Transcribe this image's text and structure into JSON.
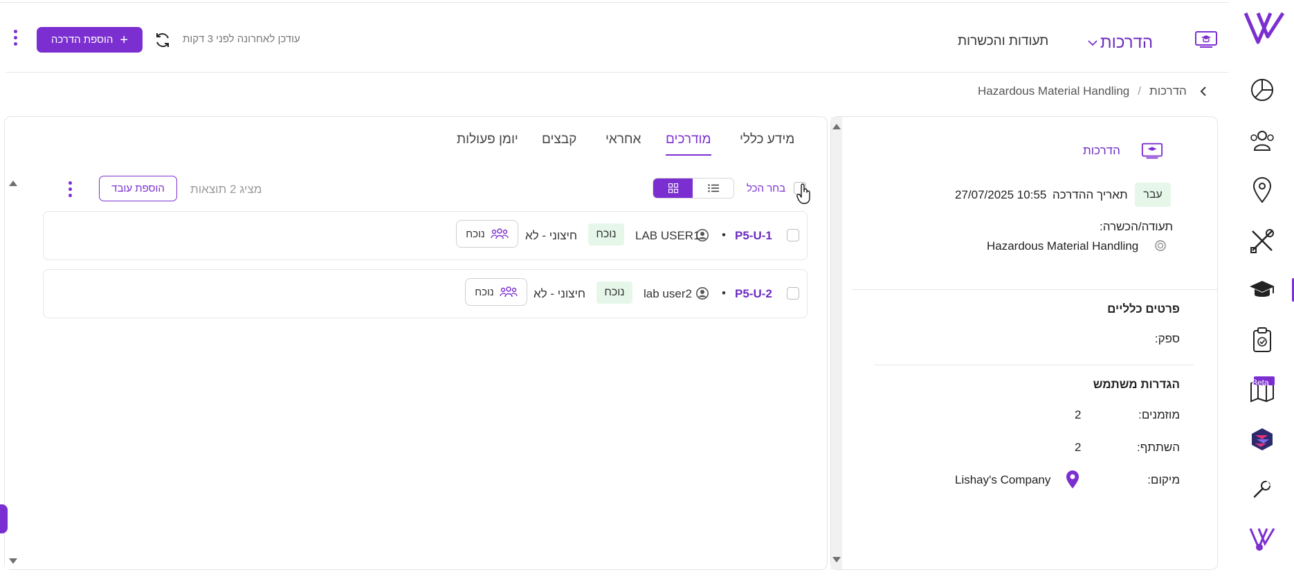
{
  "colors": {
    "accent": "#7b2fd0",
    "success_bg": "#e6f7ea"
  },
  "header": {
    "nav_trainings": "הדרכות",
    "nav_certs": "תעודות והכשרות",
    "updated_text": "עודכן לאחרונה לפני 3 דקות",
    "add_training": "הוספת הדרכה",
    "add_icon": "+"
  },
  "breadcrumb": {
    "root": "הדרכות",
    "separator": "/",
    "current": "Hazardous Material Handling"
  },
  "details": {
    "section_title": "הדרכות",
    "status": "עבר",
    "date_label": "תאריך ההדרכה",
    "date_value": "27/07/2025 10:55",
    "cert_label": "תעודה/הכשרה:",
    "cert_value": "Hazardous Material Handling",
    "general_title": "פרטים כלליים",
    "supplier_label": "ספק:",
    "user_settings_title": "הגדרות משתמש",
    "invited_label": "מוזמנים:",
    "invited_value": "2",
    "participated_label": "השתתף:",
    "participated_value": "2",
    "location_label": "מיקום:",
    "location_value": "Lishay's Company"
  },
  "tabs": [
    "מידע כללי",
    "מודרכים",
    "אחראי",
    "קבצים",
    "יומן פעולות"
  ],
  "toolbar": {
    "select_all": "בחר הכל",
    "showing": "מציג 2 תוצאות",
    "add_worker": "הוספת עובד"
  },
  "rows": [
    {
      "code": "P5-U-1",
      "bullet": "•",
      "user": "LAB USER1",
      "status": "נוכח",
      "external": "חיצוני - לא",
      "attendance": "נוכח"
    },
    {
      "code": "P5-U-2",
      "bullet": "•",
      "user": "lab user2",
      "status": "נוכח",
      "external": "חיצוני - לא",
      "attendance": "נוכח"
    }
  ],
  "rail": {
    "beta": "Beta",
    "icons": [
      "logo-icon",
      "dashboard-icon",
      "users-icon",
      "location-icon",
      "tools-icon",
      "graduation-cap-icon",
      "clipboard-check-icon",
      "map-icon",
      "layers-icon",
      "wrench-icon",
      "v-logo-icon"
    ]
  }
}
